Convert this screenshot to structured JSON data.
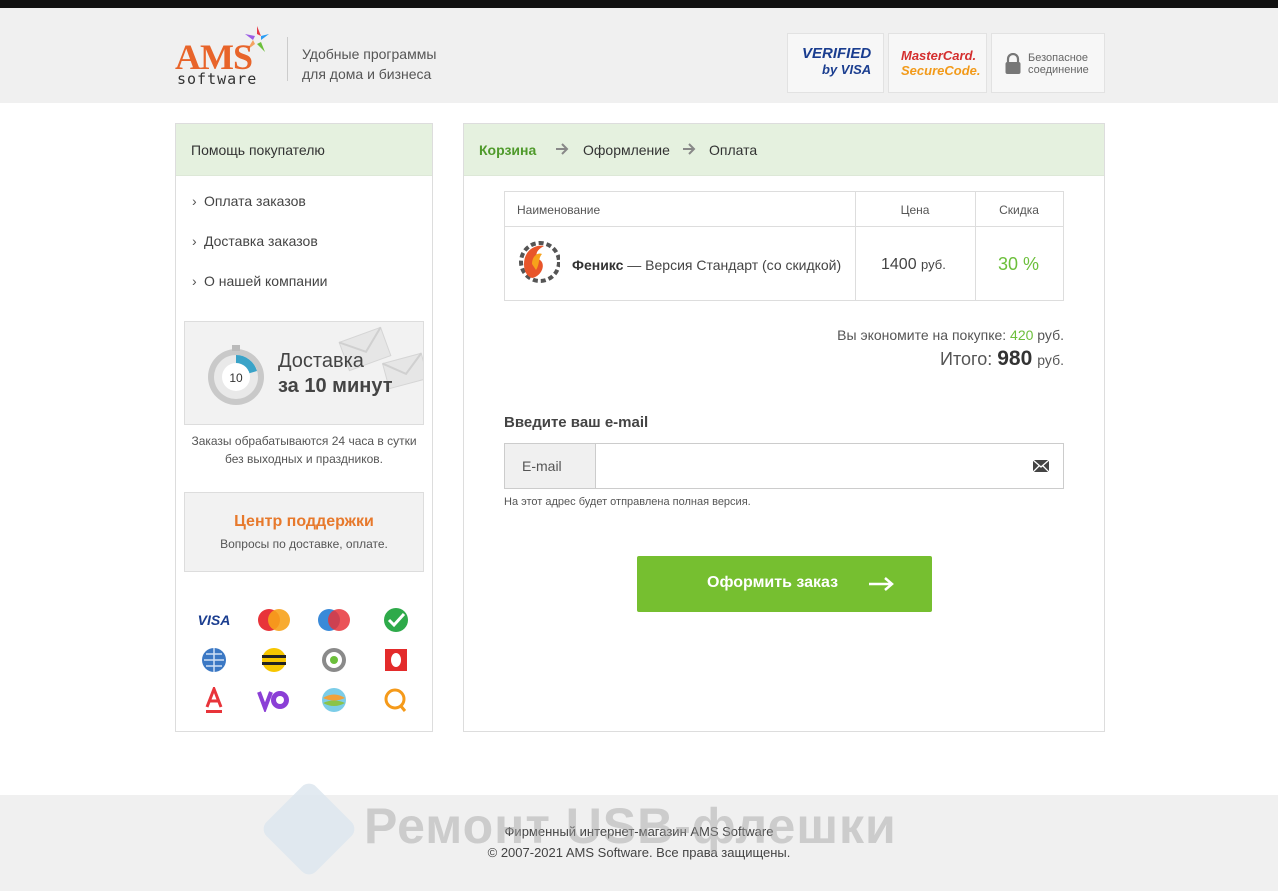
{
  "header": {
    "logo_main": "AMS",
    "logo_sub": "software",
    "tagline_1": "Удобные программы",
    "tagline_2": "для дома и бизнеса",
    "badge_visa_1": "VERIFIED",
    "badge_visa_2": "by VISA",
    "badge_mc_1": "MasterCard.",
    "badge_mc_2": "SecureCode.",
    "secure_1": "Безопасное",
    "secure_2": "соединение"
  },
  "sidebar": {
    "title": "Помощь покупателю",
    "items": [
      {
        "label": "Оплата заказов"
      },
      {
        "label": "Доставка заказов"
      },
      {
        "label": "О нашей компании"
      }
    ],
    "delivery": {
      "timer_value": "10",
      "line1": "Доставка",
      "line2": "за 10 минут",
      "note1": "Заказы обрабатываются 24 часа в сутки",
      "note2": "без выходных и праздников."
    },
    "support": {
      "title": "Центр поддержки",
      "subtitle": "Вопросы по доставке, оплате."
    },
    "payment_icons": [
      "visa-icon",
      "mastercard-icon",
      "maestro-icon",
      "sberbank-icon",
      "webmoney-icon",
      "beeline-icon",
      "qiwi-wallet-icon",
      "mts-icon",
      "alfabank-icon",
      "yoomoney-icon",
      "megafon-icon",
      "qiwi-icon"
    ],
    "visa_text": "VISA"
  },
  "checkout": {
    "steps": [
      "Корзина",
      "Оформление",
      "Оплата"
    ],
    "active_step": 0,
    "table": {
      "columns": [
        "Наименование",
        "Цена",
        "Скидка"
      ],
      "rows": [
        {
          "product_name": "Феникс",
          "product_edition": " — Версия Стандарт (со скидкой)",
          "price": "1400",
          "currency": "руб.",
          "discount": "30 %"
        }
      ]
    },
    "savings_label": "Вы экономите на покупке:",
    "savings_value": "420",
    "savings_currency": "руб.",
    "total_label": "Итого:",
    "total_value": "980",
    "total_currency": "руб.",
    "email_heading": "Введите ваш e-mail",
    "email_prefix": "E-mail",
    "email_value": "",
    "email_note": "На этот адрес будет отправлена полная версия.",
    "submit_label": "Оформить заказ"
  },
  "footer": {
    "line1": "Фирменный интернет-магазин AMS Software",
    "line2": "© 2007-2021 AMS Software. Все права защищены.",
    "watermark": "Ремонт USB-флешки"
  },
  "colors": {
    "accent_green": "#76bf30",
    "panel_green": "#e5f1df",
    "support_orange": "#e7792c",
    "discount_green": "#6cbf3b"
  }
}
